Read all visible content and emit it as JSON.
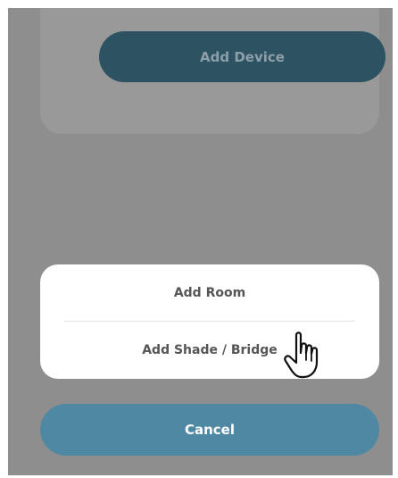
{
  "background": {
    "add_device_label": "Add Device"
  },
  "action_sheet": {
    "items": [
      {
        "label": "Add Room"
      },
      {
        "label": "Add Shade / Bridge"
      }
    ],
    "cancel_label": "Cancel"
  },
  "cursor": {
    "icon": "pointing-hand-icon"
  },
  "colors": {
    "overlay": "#8e8e8e",
    "add_device_button": "#2d5261",
    "cancel_button": "#4f88a3",
    "sheet_background": "#ffffff",
    "sheet_text": "#555555"
  }
}
